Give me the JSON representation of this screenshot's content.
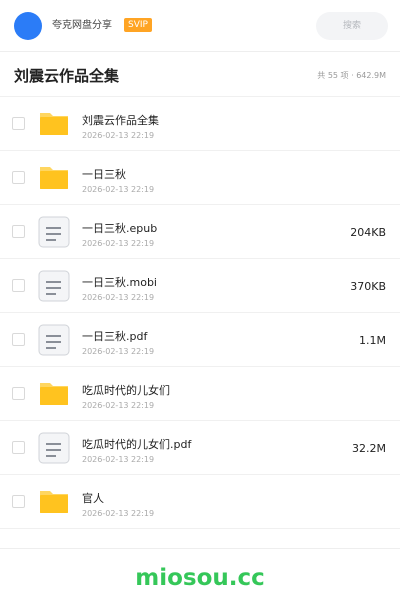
{
  "header": {
    "share_name": "夸克网盘分享",
    "badge": "SVIP",
    "search_placeholder": "搜索"
  },
  "folder": {
    "title": "刘震云作品全集",
    "summary": "共 55 项 · 642.9M"
  },
  "files": [
    {
      "type": "folder",
      "name": "刘震云作品全集",
      "date": "2026-02-13 22:19",
      "size": ""
    },
    {
      "type": "folder",
      "name": "一日三秋",
      "date": "2026-02-13 22:19",
      "size": ""
    },
    {
      "type": "doc",
      "name": "一日三秋.epub",
      "date": "2026-02-13 22:19",
      "size": "204KB"
    },
    {
      "type": "doc",
      "name": "一日三秋.mobi",
      "date": "2026-02-13 22:19",
      "size": "370KB"
    },
    {
      "type": "doc",
      "name": "一日三秋.pdf",
      "date": "2026-02-13 22:19",
      "size": "1.1M"
    },
    {
      "type": "folder",
      "name": "吃瓜时代的儿女们",
      "date": "2026-02-13 22:19",
      "size": ""
    },
    {
      "type": "doc",
      "name": "吃瓜时代的儿女们.pdf",
      "date": "2026-02-13 22:19",
      "size": "32.2M"
    },
    {
      "type": "folder",
      "name": "官人",
      "date": "2026-02-13 22:19",
      "size": ""
    }
  ],
  "footer": {
    "brand": "miosou.cc"
  },
  "colors": {
    "accent": "#2b7cf7",
    "svip": "#ffa424",
    "folder": "#ffc31f",
    "brand": "#35c759"
  },
  "icons": {
    "folder": "folder-icon",
    "doc": "document-icon"
  }
}
